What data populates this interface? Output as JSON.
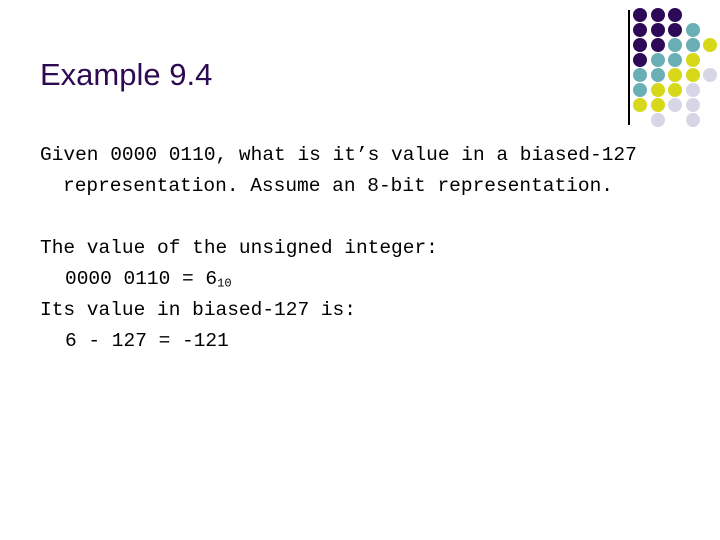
{
  "slide": {
    "title": "Example 9.4",
    "title_color": "#2E0A54",
    "background_color": "#FFFFFF",
    "body_text_color": "#000000"
  },
  "content": {
    "question": "Given 0000 0110, what is it’s value in a biased-127 representation. Assume an 8-bit representation.",
    "answer_line_1": "The value of the unsigned integer:",
    "answer_line_2_base": "0000 0110 = 6",
    "answer_line_2_subscript": "10",
    "answer_line_3": "Its value in biased-127 is:",
    "answer_line_4": "6 - 127 = -121"
  },
  "decoration": {
    "name": "dot-grid-decoration",
    "rule_color": "#000000",
    "colors": {
      "purple": "#2D0A57",
      "teal": "#6AAFB5",
      "yellow": "#D7D819",
      "lavender": "#D6D6E6"
    },
    "grid": [
      [
        "purple",
        "purple",
        "purple",
        null,
        null
      ],
      [
        "purple",
        "purple",
        "purple",
        "teal",
        null
      ],
      [
        "purple",
        "purple",
        "teal",
        "teal",
        "yellow"
      ],
      [
        "purple",
        "teal",
        "teal",
        "yellow",
        null
      ],
      [
        "teal",
        "teal",
        "yellow",
        "yellow",
        "lavender"
      ],
      [
        "teal",
        "yellow",
        "yellow",
        "lavender",
        null
      ],
      [
        "yellow",
        "yellow",
        "lavender",
        "lavender",
        null
      ],
      [
        null,
        "lavender",
        null,
        "lavender",
        null
      ]
    ]
  }
}
